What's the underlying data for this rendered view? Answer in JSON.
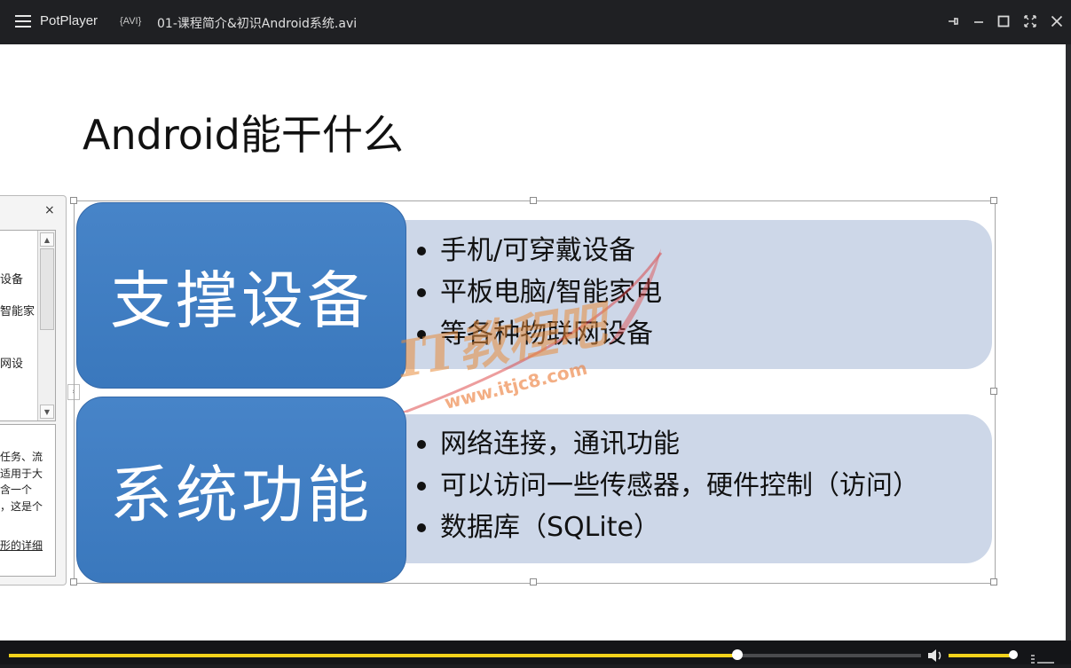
{
  "titlebar": {
    "app_name": "PotPlayer",
    "format": "{AVI}",
    "filename": "01-课程简介&初识Android系统.avi"
  },
  "slide": {
    "title": "Android能干什么",
    "sections": [
      {
        "heading": "支撑设备",
        "bullets": [
          "手机/可穿戴设备",
          "平板电脑/智能家电",
          "等各种物联网设备"
        ]
      },
      {
        "heading": "系统功能",
        "bullets": [
          "网络连接，通讯功能",
          "可以访问一些传感器，硬件控制（访问）",
          "数据库（SQLite）"
        ]
      }
    ]
  },
  "side_panel": {
    "close": "×",
    "list_fragments": [
      "设备",
      "智能家",
      "网设"
    ],
    "note_lines": [
      "任务、流",
      "适用于大",
      "含一个",
      "，这是个",
      "形的详细"
    ]
  },
  "watermark": {
    "brand": "IT教程吧",
    "url": "www.itjc8.com"
  },
  "playback": {
    "progress": 0.799,
    "volume": 0.99
  },
  "colors": {
    "accent": "#f2d21b",
    "box_dark": "#3f7ec4",
    "box_light": "#cdd7e8"
  }
}
